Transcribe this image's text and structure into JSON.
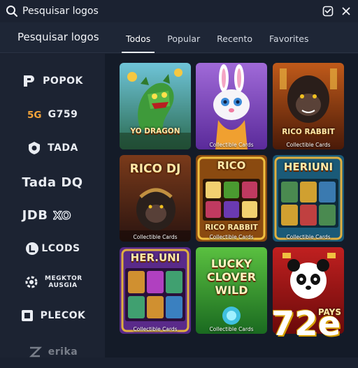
{
  "search": {
    "value": "Pesquisar logos"
  },
  "header": {
    "title": "Pesquisar logos",
    "tabs": [
      {
        "label": "Todos",
        "active": true
      },
      {
        "label": "Popular",
        "active": false
      },
      {
        "label": "Recento",
        "active": false
      },
      {
        "label": "Favorites",
        "active": false
      }
    ]
  },
  "sidebar": {
    "providers": [
      {
        "label": "POPOK",
        "icon": "p-logo-icon"
      },
      {
        "label": "G759",
        "icon": "g-logo-icon"
      },
      {
        "label": "TADA",
        "icon": "shield-logo-icon"
      },
      {
        "label": "Tada DQ",
        "icon": ""
      },
      {
        "label": "JDB",
        "icon": "xo-logo-icon"
      },
      {
        "label": "LCODS",
        "icon": "l-logo-icon"
      },
      {
        "label": "MEGKTOR AUSGIA",
        "icon": "gear-logo-icon"
      },
      {
        "label": "PLECOK",
        "icon": "cube-logo-icon"
      },
      {
        "label": "erika",
        "icon": "z-logo-icon"
      }
    ]
  },
  "games": [
    {
      "title": "YO DRAGON",
      "caption": ""
    },
    {
      "title": "",
      "caption": "Collectible Cards"
    },
    {
      "title": "RICO RABBIT",
      "caption": "Collectible Cards"
    },
    {
      "title": "RICO DJ",
      "caption": "Collectible Cards"
    },
    {
      "title": "RICO RABBIT",
      "top": "RICO",
      "caption": "Collectible Cards"
    },
    {
      "title": "HERIUNI",
      "caption": "Collectible Cards"
    },
    {
      "title": "HER.UNI",
      "caption": "Collectible Cards"
    },
    {
      "title": "LUCKY CLOVER WILD",
      "caption": "Collectible Cards"
    },
    {
      "title": "PAYS",
      "caption": ""
    }
  ],
  "watermark": "72e",
  "colors": {
    "background": "#1a2130",
    "panel": "#141b28",
    "accent": "#e8ecf2"
  }
}
